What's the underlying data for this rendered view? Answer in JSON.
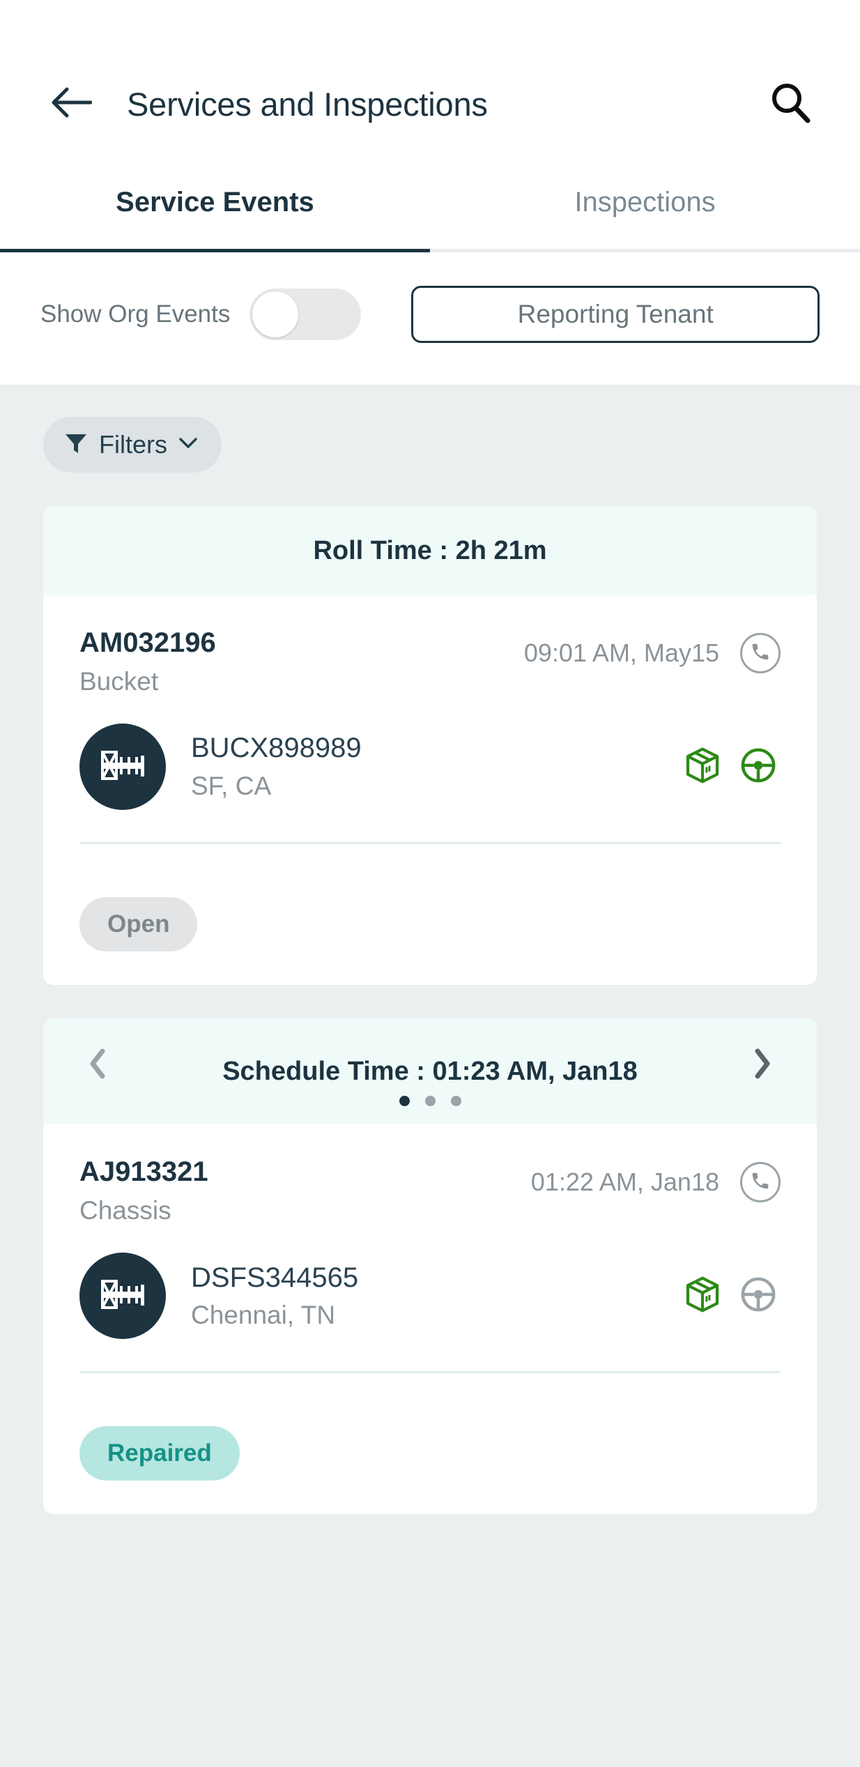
{
  "header": {
    "title": "Services and Inspections",
    "back_icon": "arrow-left-icon",
    "search_icon": "search-icon"
  },
  "tabs": [
    {
      "label": "Service Events",
      "active": true
    },
    {
      "label": "Inspections",
      "active": false
    }
  ],
  "controls": {
    "org_events_label": "Show Org Events",
    "org_events_toggle_on": false,
    "tenant_button_label": "Reporting Tenant"
  },
  "filters": {
    "label": "Filters",
    "funnel_icon": "funnel-icon",
    "chevron_icon": "chevron-down-icon"
  },
  "cards": [
    {
      "head": {
        "title": "Roll Time :  2h 21m",
        "has_nav": false
      },
      "event_id": "AM032196",
      "event_type": "Bucket",
      "event_time": "09:01 AM, May15",
      "phone_icon": "phone-icon",
      "avatar_icon": "chassis-icon",
      "asset_id": "BUCX898989",
      "asset_location": "SF, CA",
      "icons": [
        {
          "name": "package-icon",
          "color": "#2d8a17"
        },
        {
          "name": "steering-wheel-icon",
          "color": "#2d8a17"
        }
      ],
      "status": {
        "label": "Open",
        "style": "open"
      }
    },
    {
      "head": {
        "title": "Schedule Time :  01:23 AM, Jan18",
        "has_nav": true,
        "prev_icon": "chevron-left-icon",
        "next_icon": "chevron-right-icon",
        "dots_total": 3,
        "dots_active_index": 0
      },
      "event_id": "AJ913321",
      "event_type": "Chassis",
      "event_time": "01:22 AM, Jan18",
      "phone_icon": "phone-icon",
      "avatar_icon": "chassis-icon",
      "asset_id": "DSFS344565",
      "asset_location": "Chennai, TN",
      "icons": [
        {
          "name": "package-icon",
          "color": "#2d8a17"
        },
        {
          "name": "steering-wheel-icon",
          "color": "#9aa3a8"
        }
      ],
      "status": {
        "label": "Repaired",
        "style": "repaired"
      }
    }
  ],
  "colors": {
    "primary_dark": "#1d3340",
    "page_background": "#eceff0",
    "card_header": "#effaf9",
    "accent_green": "#2d8a17",
    "accent_teal": "#169187",
    "muted_gray": "#8b9399"
  }
}
